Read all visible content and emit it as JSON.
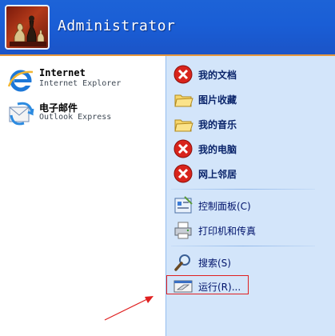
{
  "header": {
    "user_name": "Administrator"
  },
  "left_items": [
    {
      "title": "Internet",
      "subtitle": "Internet Explorer",
      "icon": "internet-explorer-icon"
    },
    {
      "title": "电子邮件",
      "subtitle": "Outlook Express",
      "icon": "outlook-express-icon"
    }
  ],
  "right_items": [
    {
      "label": "我的文档",
      "icon": "red-x-icon"
    },
    {
      "label": "图片收藏",
      "icon": "folder-icon"
    },
    {
      "label": "我的音乐",
      "icon": "folder-icon"
    },
    {
      "label": "我的电脑",
      "icon": "red-x-icon"
    },
    {
      "label": "网上邻居",
      "icon": "red-x-icon"
    },
    {
      "label": "控制面板(C)",
      "icon": "control-panel-icon"
    },
    {
      "label": "打印机和传真",
      "icon": "printer-icon"
    },
    {
      "label": "搜索(S)",
      "icon": "search-icon"
    },
    {
      "label": "运行(R)...",
      "icon": "run-icon"
    }
  ],
  "colors": {
    "header_blue": "#1d63d7",
    "right_panel": "#d3e5fa",
    "highlight_red": "#e02020",
    "header_orange_line": "#e5973d"
  }
}
